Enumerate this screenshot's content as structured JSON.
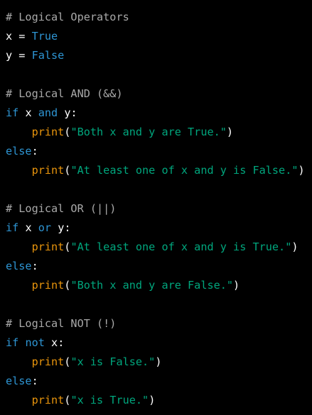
{
  "colors": {
    "background": "#000000",
    "comment": "#a9a9a9",
    "identifier": "#ffffff",
    "keyword": "#2e95d3",
    "builtin": "#e9950c",
    "string": "#00a67d"
  },
  "code": {
    "language": "python",
    "lines": [
      [
        [
          "comment",
          "# Logical Operators"
        ]
      ],
      [
        [
          "ident",
          "x"
        ],
        [
          "op",
          " = "
        ],
        [
          "literal",
          "True"
        ]
      ],
      [
        [
          "ident",
          "y"
        ],
        [
          "op",
          " = "
        ],
        [
          "literal",
          "False"
        ]
      ],
      [],
      [
        [
          "comment",
          "# Logical AND (&&)"
        ]
      ],
      [
        [
          "keyword",
          "if"
        ],
        [
          "ws",
          " "
        ],
        [
          "ident",
          "x"
        ],
        [
          "ws",
          " "
        ],
        [
          "keyword",
          "and"
        ],
        [
          "ws",
          " "
        ],
        [
          "ident",
          "y"
        ],
        [
          "punct",
          ":"
        ]
      ],
      [
        [
          "ws",
          "    "
        ],
        [
          "builtin",
          "print"
        ],
        [
          "punct",
          "("
        ],
        [
          "string",
          "\"Both x and y are True.\""
        ],
        [
          "punct",
          ")"
        ]
      ],
      [
        [
          "keyword",
          "else"
        ],
        [
          "punct",
          ":"
        ]
      ],
      [
        [
          "ws",
          "    "
        ],
        [
          "builtin",
          "print"
        ],
        [
          "punct",
          "("
        ],
        [
          "string",
          "\"At least one of x and y is False.\""
        ],
        [
          "punct",
          ")"
        ]
      ],
      [],
      [
        [
          "comment",
          "# Logical OR (||)"
        ]
      ],
      [
        [
          "keyword",
          "if"
        ],
        [
          "ws",
          " "
        ],
        [
          "ident",
          "x"
        ],
        [
          "ws",
          " "
        ],
        [
          "keyword",
          "or"
        ],
        [
          "ws",
          " "
        ],
        [
          "ident",
          "y"
        ],
        [
          "punct",
          ":"
        ]
      ],
      [
        [
          "ws",
          "    "
        ],
        [
          "builtin",
          "print"
        ],
        [
          "punct",
          "("
        ],
        [
          "string",
          "\"At least one of x and y is True.\""
        ],
        [
          "punct",
          ")"
        ]
      ],
      [
        [
          "keyword",
          "else"
        ],
        [
          "punct",
          ":"
        ]
      ],
      [
        [
          "ws",
          "    "
        ],
        [
          "builtin",
          "print"
        ],
        [
          "punct",
          "("
        ],
        [
          "string",
          "\"Both x and y are False.\""
        ],
        [
          "punct",
          ")"
        ]
      ],
      [],
      [
        [
          "comment",
          "# Logical NOT (!)"
        ]
      ],
      [
        [
          "keyword",
          "if"
        ],
        [
          "ws",
          " "
        ],
        [
          "keyword",
          "not"
        ],
        [
          "ws",
          " "
        ],
        [
          "ident",
          "x"
        ],
        [
          "punct",
          ":"
        ]
      ],
      [
        [
          "ws",
          "    "
        ],
        [
          "builtin",
          "print"
        ],
        [
          "punct",
          "("
        ],
        [
          "string",
          "\"x is False.\""
        ],
        [
          "punct",
          ")"
        ]
      ],
      [
        [
          "keyword",
          "else"
        ],
        [
          "punct",
          ":"
        ]
      ],
      [
        [
          "ws",
          "    "
        ],
        [
          "builtin",
          "print"
        ],
        [
          "punct",
          "("
        ],
        [
          "string",
          "\"x is True.\""
        ],
        [
          "punct",
          ")"
        ]
      ]
    ]
  }
}
